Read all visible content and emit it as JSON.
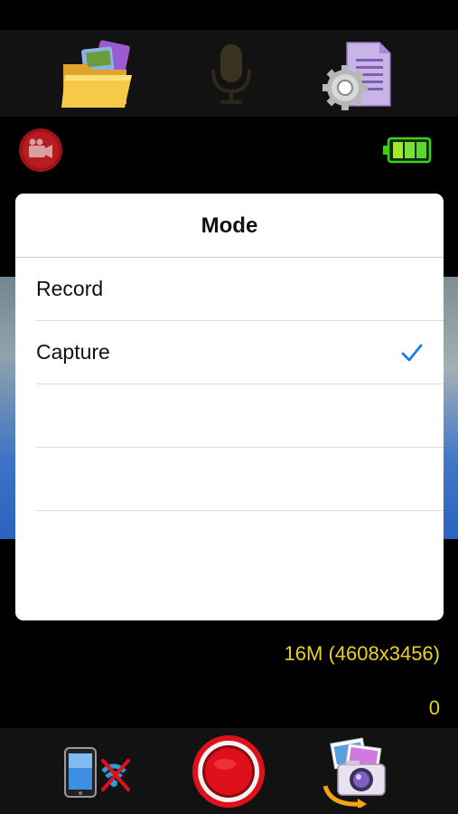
{
  "toolbar": {
    "icons": [
      "folder-gallery-icon",
      "microphone-icon",
      "settings-document-icon"
    ]
  },
  "status": {
    "mode_icon": "video-camera-icon",
    "battery_icon": "battery-icon",
    "battery_color": "#3bd21c"
  },
  "mode_dialog": {
    "title": "Mode",
    "options": [
      {
        "label": "Record",
        "selected": false
      },
      {
        "label": "Capture",
        "selected": true
      },
      {
        "label": "",
        "selected": false
      },
      {
        "label": "",
        "selected": false
      },
      {
        "label": "",
        "selected": false
      }
    ],
    "check_color": "#1a7cf5"
  },
  "info": {
    "resolution": "16M (4608x3456)",
    "count": "0",
    "text_color": "#e8d21a"
  },
  "bottom_bar": {
    "icons": [
      "phone-wifi-off-icon",
      "record-shutter-button",
      "photo-switch-icon"
    ],
    "shutter_color": "#e0101a"
  }
}
